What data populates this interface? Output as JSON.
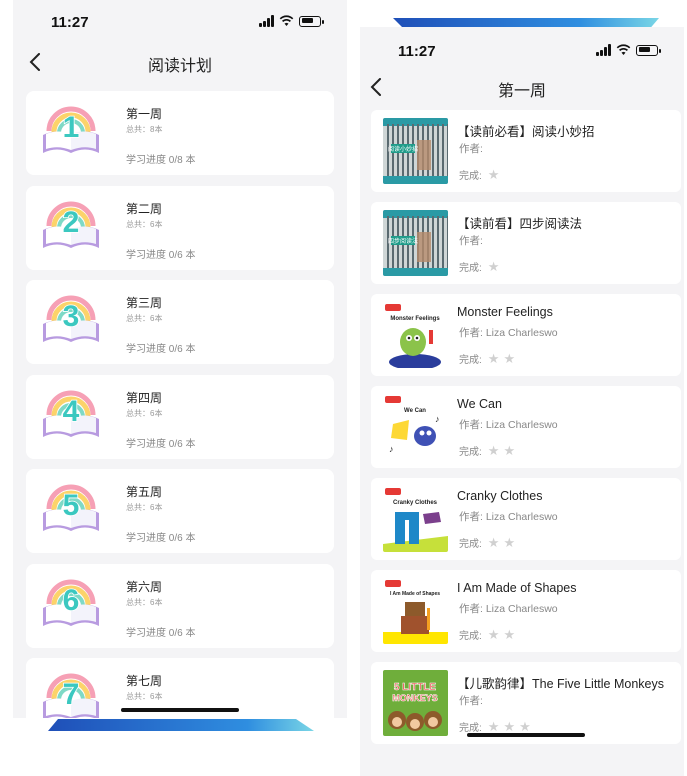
{
  "left": {
    "time": "11:27",
    "title": "阅读计划",
    "plans": [
      {
        "num": "1",
        "title": "第一周",
        "total": "总共：8本",
        "progress": "学习进度 0/8 本"
      },
      {
        "num": "2",
        "title": "第二周",
        "total": "总共：6本",
        "progress": "学习进度 0/6 本"
      },
      {
        "num": "3",
        "title": "第三周",
        "total": "总共：6本",
        "progress": "学习进度 0/6 本"
      },
      {
        "num": "4",
        "title": "第四周",
        "total": "总共：6本",
        "progress": "学习进度 0/6 本"
      },
      {
        "num": "5",
        "title": "第五周",
        "total": "总共：6本",
        "progress": "学习进度 0/6 本"
      },
      {
        "num": "6",
        "title": "第六周",
        "total": "总共：6本",
        "progress": "学习进度 0/6 本"
      },
      {
        "num": "7",
        "title": "第七周",
        "total": "总共：6本",
        "progress": ""
      }
    ]
  },
  "right": {
    "time": "11:27",
    "title": "第一周",
    "books": [
      {
        "title": "【读前必看】阅读小妙招",
        "author": "作者:",
        "done_label": "完成:",
        "stars": 1,
        "cover": "reading-tips",
        "cover_text": "阅读小妙招"
      },
      {
        "title": "【读前看】四步阅读法",
        "author": "作者:",
        "done_label": "完成:",
        "stars": 1,
        "cover": "four-steps",
        "cover_text": "四步阅读法"
      },
      {
        "title": "Monster Feelings",
        "author": "作者: Liza Charleswo",
        "done_label": "完成:",
        "stars": 2,
        "cover": "monster",
        "cover_text": "Monster Feelings"
      },
      {
        "title": "We Can",
        "author": "作者: Liza Charleswo",
        "done_label": "完成:",
        "stars": 2,
        "cover": "wecan",
        "cover_text": "We Can"
      },
      {
        "title": "Cranky Clothes",
        "author": "作者: Liza Charleswo",
        "done_label": "完成:",
        "stars": 2,
        "cover": "cranky",
        "cover_text": "Cranky Clothes"
      },
      {
        "title": "I Am Made of Shapes",
        "author": "作者: Liza Charleswo",
        "done_label": "完成:",
        "stars": 2,
        "cover": "shapes",
        "cover_text": "I Am Made of Shapes"
      },
      {
        "title": "【儿歌韵律】The Five Little Monkeys",
        "author": "作者:",
        "done_label": "完成:",
        "stars": 3,
        "cover": "monkeys",
        "cover_text": "5 LITTLE MONKEYS"
      }
    ]
  },
  "colors": {
    "accent_teal": "#3bc8c0",
    "book_purple": "#b89be0",
    "star_gray": "#d0d0d0",
    "band_blue": "#2a6fd8"
  }
}
